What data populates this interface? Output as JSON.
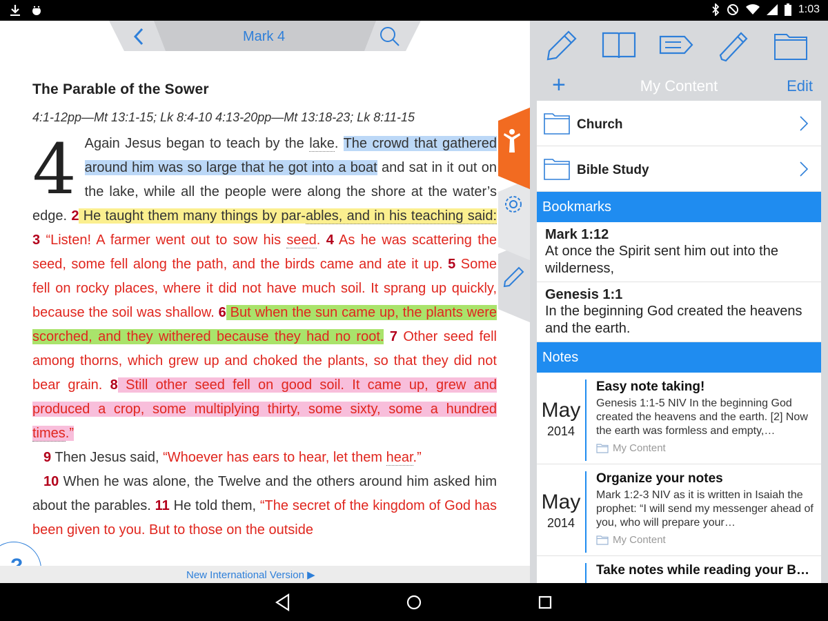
{
  "status_bar": {
    "time": "1:03"
  },
  "reader": {
    "reference": "Mark 4",
    "section_heading": "The Parable of the Sower",
    "parallel_refs": "4:1-12pp—Mt 13:1-15; Lk 8:4-10 4:13-20pp—Mt 13:18-23; Lk 8:11-15",
    "drop_cap": "4",
    "para1": {
      "t1": "Again Jesus began to teach by the ",
      "w_lake": "lake",
      "t2": ". ",
      "hl_blue": "The crowd that gathered around him was so large that he got into a boat",
      "t3": " and sat in it out on the lake, while all the people were along the shore at the water’s edge. ",
      "v2": "2",
      "hl_yellow_a": " He taught them many things by par-",
      "hl_yellow_b": "ables, and in his teaching said:",
      "t4": " ",
      "v3": "3",
      "r1": " “Listen! A farmer went out to sow his ",
      "w_seed": "seed",
      "r2": ". ",
      "v4": "4",
      "r3": " As he was scattering the seed, some fell along the path, and the birds came and ate it up. ",
      "v5": "5",
      "r4": " Some fell on rocky places, where it did not have much soil. It sprang up quickly, because the soil was shallow. ",
      "v6": "6",
      "hl_green": " But when the sun came up, the plants were scorched, and they withered because they had no root.",
      "r5": " ",
      "v7": "7",
      "r6": " Other seed fell among thorns, which grew up and choked the plants, so that they did not bear grain. ",
      "v8": "8",
      "hl_pink_a": " Still other seed fell on good soil. It came up, grew and produced a crop, some multiplying thirty, some sixty, some a hundred ",
      "w_times": "times",
      "hl_pink_b": ".”"
    },
    "para2": {
      "v9": "9",
      "t1": " Then Jesus said, ",
      "r1": "“Whoever has ears to hear, let them ",
      "w_hear": "hear",
      "r2": ".”"
    },
    "para3": {
      "v10": "10",
      "t1": " When he was alone, the Twelve and the others around him asked him about the parables. ",
      "v11": "11",
      "t2": " He told them, ",
      "r1": "“The secret of the kingdom of God has been given to you. But to those on the outside"
    },
    "help_label": "?",
    "version_link": "New International Version ▶"
  },
  "panel": {
    "toolbar_icons": [
      "pencil-icon",
      "book-icon",
      "tag-icon",
      "highlighter-icon",
      "folder-icon"
    ],
    "add_label": "+",
    "title": "My Content",
    "edit_label": "Edit",
    "folders": [
      {
        "label": "Church"
      },
      {
        "label": "Bible Study"
      }
    ],
    "bookmarks_header": "Bookmarks",
    "bookmarks": [
      {
        "ref": "Mark 1:12",
        "text": "At once the Spirit sent him out into the wilderness,"
      },
      {
        "ref": "Genesis 1:1",
        "text": "In the beginning God created the heavens and the earth."
      }
    ],
    "notes_header": "Notes",
    "notes": [
      {
        "month": "May",
        "year": "2014",
        "title": "Easy note taking!",
        "excerpt": "Genesis 1:1-5 NIV In the beginning God created the heavens and the earth. [2] Now the earth was formless and empty,…",
        "folder": "My Content"
      },
      {
        "month": "May",
        "year": "2014",
        "title": "Organize your notes",
        "excerpt": "Mark 1:2-3 NIV as it is written in Isaiah the prophet:  “I will send my messenger ahead of you, who will prepare your…",
        "folder": "My Content"
      },
      {
        "month": "",
        "year": "",
        "title": "Take notes while reading your B…",
        "excerpt": "",
        "folder": ""
      }
    ]
  },
  "colors": {
    "accent": "#2e7fd9",
    "section_header": "#1f8cf0",
    "words_of_christ": "#e0261e",
    "tab_orange": "#f26b21"
  }
}
